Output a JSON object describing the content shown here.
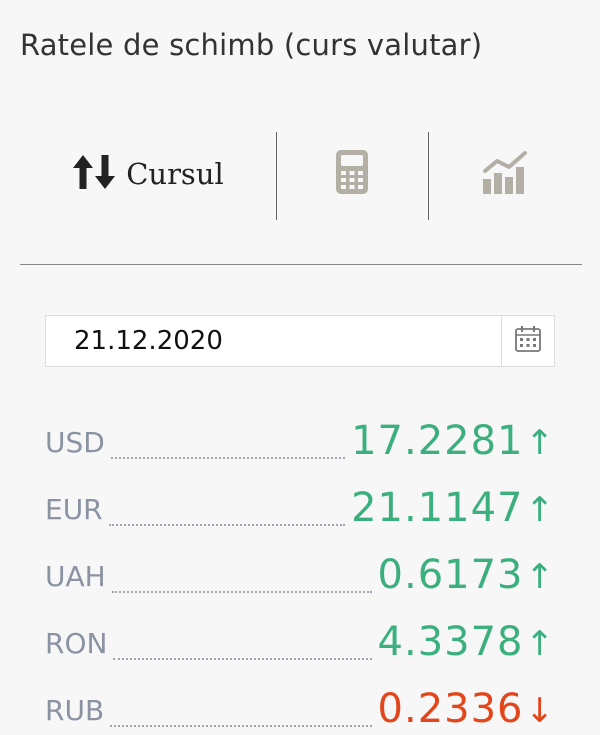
{
  "title": "Ratele de schimb (curs valutar)",
  "tabs": {
    "cursul_label": "Cursul",
    "cursul_icon": "sort-up-down-icon",
    "calculator_icon": "calculator-icon",
    "chart_icon": "chart-icon"
  },
  "date": {
    "value": "21.12.2020",
    "calendar_icon": "calendar-icon"
  },
  "colors": {
    "up": "#3bb07e",
    "down": "#e2461a",
    "code": "#8b93a3",
    "icon_inactive": "#b4afa4"
  },
  "rates": [
    {
      "code": "USD",
      "value": "17.2281",
      "arrow": "↑",
      "trend": "up"
    },
    {
      "code": "EUR",
      "value": "21.1147",
      "arrow": "↑",
      "trend": "up"
    },
    {
      "code": "UAH",
      "value": "0.6173",
      "arrow": "↑",
      "trend": "up"
    },
    {
      "code": "RON",
      "value": "4.3378",
      "arrow": "↑",
      "trend": "up"
    },
    {
      "code": "RUB",
      "value": "0.2336",
      "arrow": "↓",
      "trend": "down"
    }
  ]
}
